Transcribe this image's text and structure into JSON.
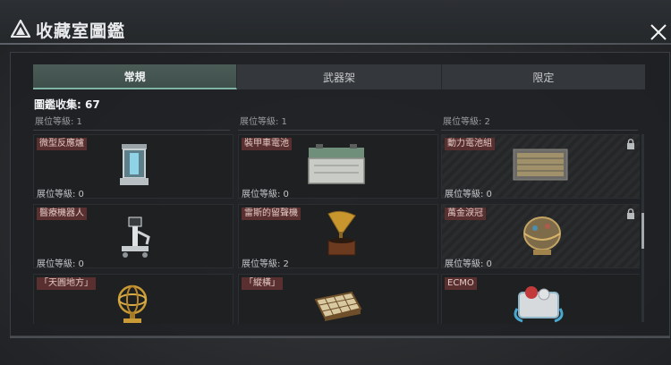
{
  "header": {
    "title": "收藏室圖鑑"
  },
  "tabs": [
    {
      "label": "常規",
      "active": true
    },
    {
      "label": "武器架",
      "active": false
    },
    {
      "label": "限定",
      "active": false
    }
  ],
  "collection": {
    "count_label": "圖鑑收集: 67"
  },
  "partial_row": [
    {
      "level_label": "展位等級: 1"
    },
    {
      "level_label": "展位等級: 1"
    },
    {
      "level_label": "展位等級: 2"
    }
  ],
  "items": [
    {
      "name": "微型反應爐",
      "level_label": "展位等級: 0",
      "locked": false,
      "icon": "reactor-icon"
    },
    {
      "name": "裝甲車電池",
      "level_label": "展位等級: 0",
      "locked": false,
      "icon": "battery-icon"
    },
    {
      "name": "動力電池組",
      "level_label": "展位等級: 0",
      "locked": true,
      "icon": "power-cell-icon"
    },
    {
      "name": "醫療機器人",
      "level_label": "展位等級: 0",
      "locked": false,
      "icon": "medical-robot-icon"
    },
    {
      "name": "雷斯的留聲機",
      "level_label": "展位等級: 2",
      "locked": false,
      "icon": "gramophone-icon"
    },
    {
      "name": "萬金淚冠",
      "level_label": "展位等級: 0",
      "locked": true,
      "icon": "egg-crown-icon"
    },
    {
      "name": "「天圓地方」",
      "level_label": "",
      "locked": false,
      "icon": "armillary-icon"
    },
    {
      "name": "「縱橫」",
      "level_label": "",
      "locked": false,
      "icon": "chessboard-icon"
    },
    {
      "name": "ECMO",
      "level_label": "",
      "locked": false,
      "icon": "ecmo-icon"
    }
  ],
  "colors": {
    "accent": "#7fb3a3",
    "name_tag_bg": "#5a2f2f",
    "card_bg": "#1e2022"
  }
}
